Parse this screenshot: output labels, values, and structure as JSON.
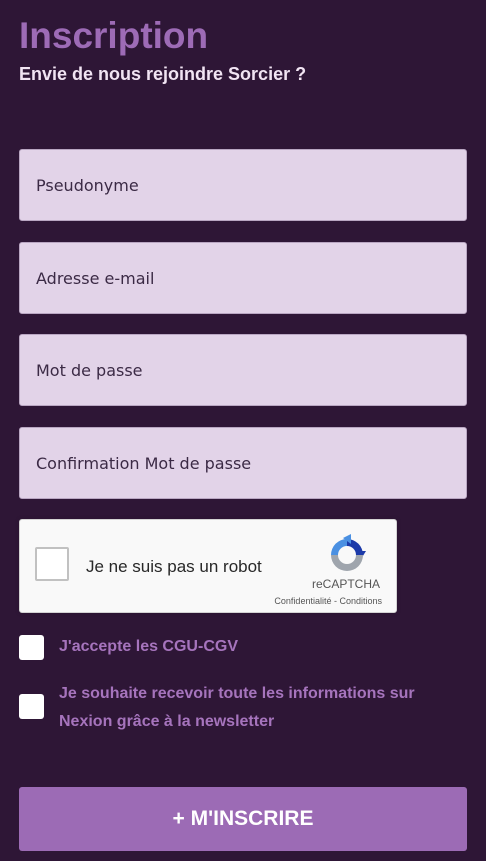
{
  "header": {
    "title": "Inscription",
    "subtitle": "Envie de nous rejoindre Sorcier ?"
  },
  "form": {
    "fields": [
      {
        "placeholder": "Pseudonyme",
        "value": ""
      },
      {
        "placeholder": "Adresse e-mail",
        "value": ""
      },
      {
        "placeholder": "Mot de passe",
        "value": ""
      },
      {
        "placeholder": "Confirmation Mot de passe",
        "value": ""
      }
    ],
    "captcha": {
      "label": "Je ne suis pas un robot",
      "brand": "reCAPTCHA",
      "privacy_link": "Confidentialité",
      "separator": " - ",
      "terms_link": "Conditions",
      "checked": false
    },
    "checkboxes": [
      {
        "label": "J'accepte les CGU-CGV",
        "checked": false
      },
      {
        "label": "Je souhaite recevoir toute les informations sur Nexion grâce à la newsletter",
        "checked": false
      }
    ],
    "submit_label": "+ M'INSCRIRE"
  },
  "colors": {
    "background": "#2e1636",
    "accent": "#9c6bb5",
    "field_background": "#e2d3e8",
    "subtitle": "#f1e4f3"
  },
  "icons": {
    "captcha_logo": "recaptcha-icon"
  }
}
